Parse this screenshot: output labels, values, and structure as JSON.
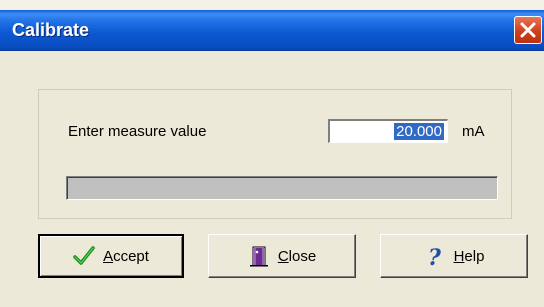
{
  "dialog": {
    "title": "Calibrate"
  },
  "measure": {
    "label": "Enter measure value",
    "value": "20.000",
    "unit": "mA"
  },
  "progress": {
    "fraction": 0
  },
  "buttons": {
    "accept": {
      "mnemonic": "A",
      "rest": "ccept",
      "icon": "checkmark-icon"
    },
    "close": {
      "mnemonic": "C",
      "rest": "lose",
      "icon": "door-exit-icon"
    },
    "help": {
      "mnemonic": "H",
      "rest": "elp",
      "icon": "question-mark-icon"
    }
  },
  "colors": {
    "titlebar": "#0b57d0",
    "selection": "#316ac5",
    "close_button": "#d0401c",
    "progress_track": "#c0c0c0"
  }
}
